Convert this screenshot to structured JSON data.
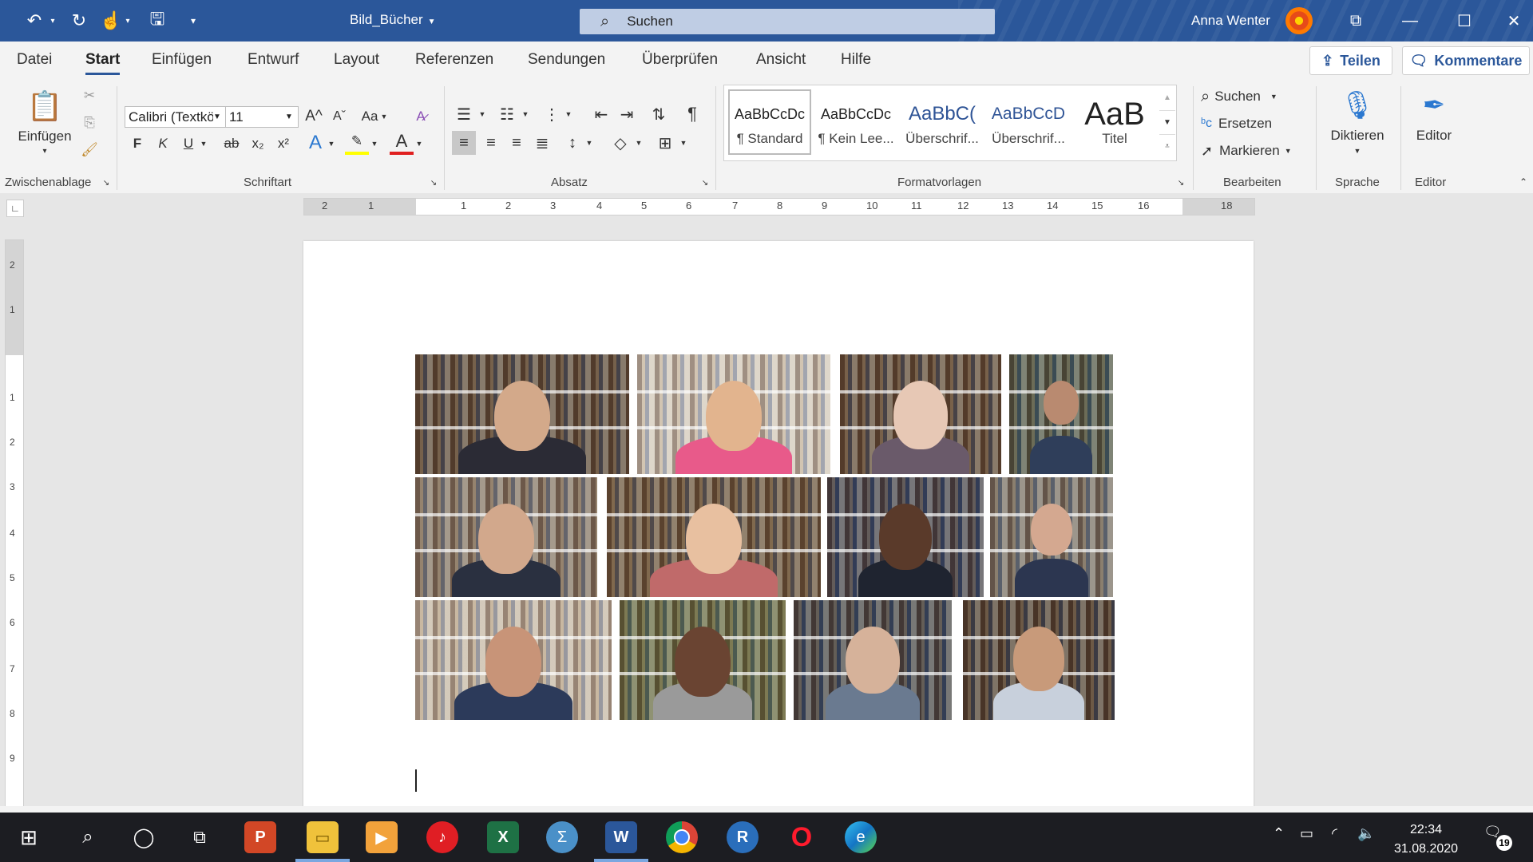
{
  "titlebar": {
    "doc_title": "Bild_Bücher",
    "search_placeholder": "Suchen",
    "user_name": "Anna Wenter"
  },
  "menu": {
    "items": [
      "Datei",
      "Start",
      "Einfügen",
      "Entwurf",
      "Layout",
      "Referenzen",
      "Sendungen",
      "Überprüfen",
      "Ansicht",
      "Hilfe"
    ],
    "active": "Start",
    "share_label": "Teilen",
    "comments_label": "Kommentare"
  },
  "ribbon": {
    "clipboard": {
      "paste_label": "Einfügen",
      "group_label": "Zwischenablage"
    },
    "font": {
      "family": "Calibri (Textkörper)",
      "size": "11",
      "bold": "F",
      "italic": "K",
      "underline": "U",
      "strike": "ab",
      "subscript": "x₂",
      "superscript": "x²",
      "change_case": "Aa",
      "group_label": "Schriftart",
      "grow": "A^",
      "shrink": "Aˇ"
    },
    "paragraph": {
      "group_label": "Absatz",
      "pilcrow": "¶"
    },
    "styles": {
      "group_label": "Formatvorlagen",
      "tiles": [
        {
          "sample": "AaBbCcDc",
          "name": "¶ Standard"
        },
        {
          "sample": "AaBbCcDc",
          "name": "¶ Kein Lee..."
        },
        {
          "sample": "AaBbC(",
          "name": "Überschrif..."
        },
        {
          "sample": "AaBbCcD",
          "name": "Überschrif..."
        },
        {
          "sample": "AaB",
          "name": "Titel"
        }
      ]
    },
    "editing": {
      "search": "Suchen",
      "replace": "Ersetzen",
      "select": "Markieren",
      "group_label": "Bearbeiten"
    },
    "voice": {
      "dictate": "Diktieren",
      "group_label": "Sprache"
    },
    "editor": {
      "label": "Editor",
      "group_label": "Editor"
    }
  },
  "ruler": {
    "numbers": [
      "2",
      "1",
      "1",
      "2",
      "3",
      "4",
      "5",
      "6",
      "7",
      "8",
      "9",
      "10",
      "11",
      "12",
      "13",
      "14",
      "15",
      "16",
      "18"
    ],
    "vnumbers": [
      "2",
      "1",
      "1",
      "2",
      "3",
      "4",
      "5",
      "6",
      "7",
      "8",
      "9"
    ]
  },
  "taskbar": {
    "time": "22:34",
    "date": "31.08.2020",
    "notifications": "19"
  },
  "colors": {
    "word_blue": "#2b579a",
    "ribbon_bg": "#f3f3f3",
    "taskbar_bg": "#1c1d22"
  }
}
